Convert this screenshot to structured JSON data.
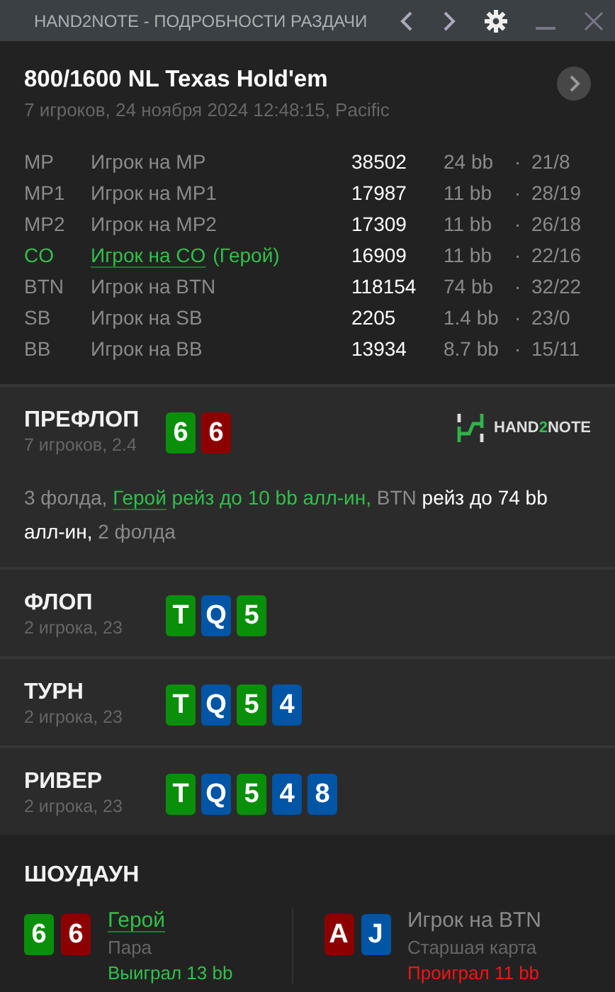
{
  "window": {
    "title": "HAND2NOTE - ПОДРОБНОСТИ РАЗДАЧИ"
  },
  "hand": {
    "title": "800/1600 NL Texas Hold'em",
    "subtitle": "7 игроков, 24 ноября 2024 12:48:15, Pacific"
  },
  "players": [
    {
      "position": "MP",
      "name": "Игрок на MP",
      "stack": "38502",
      "bb": "24 bb",
      "sep": "·",
      "stats": "21/8",
      "hero": false
    },
    {
      "position": "MP1",
      "name": "Игрок на MP1",
      "stack": "17987",
      "bb": "11 bb",
      "sep": "·",
      "stats": "28/19",
      "hero": false
    },
    {
      "position": "MP2",
      "name": "Игрок на MP2",
      "stack": "17309",
      "bb": "11 bb",
      "sep": "·",
      "stats": "26/18",
      "hero": false
    },
    {
      "position": "CO",
      "name": "Игрок на CO",
      "hero_tag": "(Герой)",
      "stack": "16909",
      "bb": "11 bb",
      "sep": "·",
      "stats": "22/16",
      "hero": true
    },
    {
      "position": "BTN",
      "name": "Игрок на BTN",
      "stack": "118154",
      "bb": "74 bb",
      "sep": "·",
      "stats": "32/22",
      "hero": false
    },
    {
      "position": "SB",
      "name": "Игрок на SB",
      "stack": "2205",
      "bb": "1.4 bb",
      "sep": "·",
      "stats": "23/0",
      "hero": false
    },
    {
      "position": "BB",
      "name": "Игрок на BB",
      "stack": "13934",
      "bb": "8.7 bb",
      "sep": "·",
      "stats": "15/11",
      "hero": false
    }
  ],
  "streets": [
    {
      "name": "ПРЕФЛОП",
      "info": "7 игроков, 2.4",
      "cards": [
        {
          "rank": "6",
          "color": "#0a8f0a"
        },
        {
          "rank": "6",
          "color": "#8c0000"
        }
      ],
      "logo": [
        "HAND",
        "2",
        "NOTE"
      ],
      "actions": [
        {
          "text": "3 фолда, ",
          "kind": "muted"
        },
        {
          "text": "Герой",
          "kind": "hero_link"
        },
        {
          "text": " рейз до 10 bb алл-ин, ",
          "kind": "hero"
        },
        {
          "text": "BTN ",
          "kind": "muted"
        },
        {
          "text": "рейз до 74 bb алл-ин, ",
          "kind": "bright"
        },
        {
          "text": "2 фолда",
          "kind": "muted"
        }
      ]
    },
    {
      "name": "ФЛОП",
      "info": "2 игрока, 23",
      "cards": [
        {
          "rank": "T",
          "color": "#0a8f0a"
        },
        {
          "rank": "Q",
          "color": "#0055a5"
        },
        {
          "rank": "5",
          "color": "#0a8f0a"
        }
      ]
    },
    {
      "name": "ТУРН",
      "info": "2 игрока, 23",
      "cards": [
        {
          "rank": "T",
          "color": "#0a8f0a"
        },
        {
          "rank": "Q",
          "color": "#0055a5"
        },
        {
          "rank": "5",
          "color": "#0a8f0a"
        },
        {
          "rank": "4",
          "color": "#0055a5"
        }
      ]
    },
    {
      "name": "РИВЕР",
      "info": "2 игрока, 23",
      "cards": [
        {
          "rank": "T",
          "color": "#0a8f0a"
        },
        {
          "rank": "Q",
          "color": "#0055a5"
        },
        {
          "rank": "5",
          "color": "#0a8f0a"
        },
        {
          "rank": "4",
          "color": "#0055a5"
        },
        {
          "rank": "8",
          "color": "#0055a5"
        }
      ]
    }
  ],
  "showdown": {
    "title": "ШОУДАУН",
    "players": [
      {
        "name": "Герой",
        "hero": true,
        "hand": "Пара",
        "result": "Выиграл 13 bb",
        "won": true,
        "cards": [
          {
            "rank": "6",
            "color": "#0a8f0a"
          },
          {
            "rank": "6",
            "color": "#8c0000"
          }
        ]
      },
      {
        "name": "Игрок на BTN",
        "hero": false,
        "hand": "Старшая карта",
        "result": "Проиграл 11 bb",
        "won": false,
        "cards": [
          {
            "rank": "A",
            "color": "#8c0000"
          },
          {
            "rank": "J",
            "color": "#0055a5"
          }
        ]
      }
    ]
  }
}
